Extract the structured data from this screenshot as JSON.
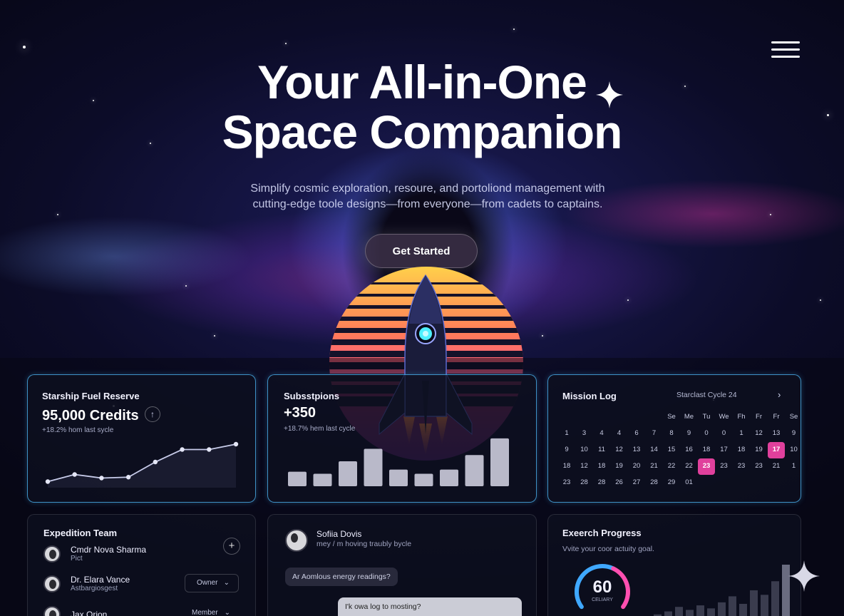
{
  "hero": {
    "title_line1": "Your All-in-One",
    "title_line2": "Space Companion",
    "subtitle_line1": "Simplify cosmic exploration, resoure, and portoliond management with",
    "subtitle_line2": "cutting-edge toole designs—from everyone—from cadets to captains.",
    "cta_label": "Get Started"
  },
  "fuel_card": {
    "title": "Starship Fuel Reserve",
    "value": "95,000 Credits",
    "delta": "+18.2% hom last sycle",
    "up_icon": "arrow-up-icon",
    "line_values": [
      2,
      10,
      6,
      7,
      24,
      38,
      38,
      44
    ]
  },
  "subs_card": {
    "title": "Subsstpions",
    "value": "+350",
    "delta": "+18.7% hem last cycle",
    "bar_values": [
      14,
      12,
      24,
      36,
      16,
      12,
      16,
      30,
      46
    ]
  },
  "mission_log": {
    "title": "Mission Log",
    "cycle_label": "Starclast Cycle 24",
    "next_icon": "chevron-right-icon",
    "weekdays": [
      "",
      "",
      "",
      "",
      "",
      "",
      "Se",
      "Me",
      "Tu",
      "We",
      "Fh",
      "Fr",
      "Fr",
      "Se"
    ],
    "rows": [
      [
        "1",
        "3",
        "4",
        "4",
        "6",
        "7",
        "8",
        "9",
        "0",
        "0",
        "1",
        "12",
        "13",
        "9"
      ],
      [
        "9",
        "10",
        "11",
        "12",
        "13",
        "14",
        "15",
        "16",
        "18",
        "17",
        "18",
        "19",
        "17",
        "10"
      ],
      [
        "18",
        "12",
        "18",
        "19",
        "20",
        "21",
        "22",
        "22",
        "23",
        "23",
        "23",
        "23",
        "21",
        "1"
      ],
      [
        "23",
        "28",
        "28",
        "26",
        "27",
        "28",
        "29",
        "01",
        "",
        "",
        "",
        "",
        "",
        ""
      ]
    ],
    "highlight_color": "#e0409c"
  },
  "team": {
    "title": "Expedition Team",
    "add_label": "+",
    "members": [
      {
        "name": "Cmdr Nova Sharma",
        "role": "Pict"
      },
      {
        "name": "Dr. Elara Vance",
        "role": "Astbargiosgest",
        "select": "Owner"
      },
      {
        "name": "Jax Orion",
        "role": "",
        "select": "Member"
      }
    ]
  },
  "chat": {
    "user_name": "Sofiia Dovis",
    "user_msg": "mey / m hoving traubly bycle",
    "bubble1": "Ar Aomlous energy readings?",
    "bubble2": "I'k owa log to mosting?"
  },
  "progress": {
    "title": "Exeerch Progress",
    "subtitle": "Vvite your coor actuity goal.",
    "value": "60",
    "gauge_label": "CELIARY",
    "gauge_fraction": 0.6,
    "bar_values": [
      4,
      8,
      14,
      10,
      16,
      12,
      20,
      28,
      18,
      36,
      30,
      48,
      70
    ]
  },
  "colors": {
    "accent_blue": "#50beff",
    "accent_pink": "#e0409c",
    "gauge_pink": "#ff4fb0",
    "gauge_blue": "#3fa8ff"
  }
}
